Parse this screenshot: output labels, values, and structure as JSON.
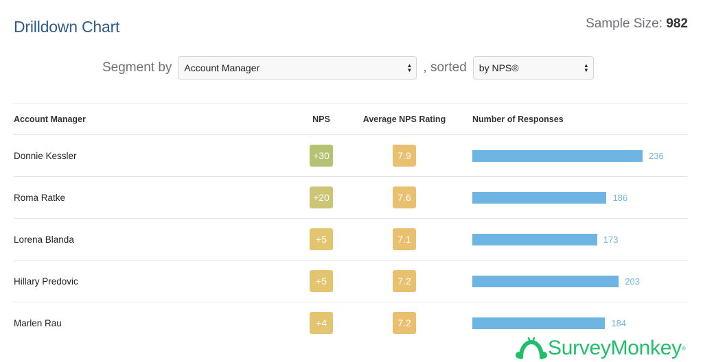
{
  "header": {
    "title": "Drilldown Chart",
    "sample_size_label": "Sample Size:",
    "sample_size_value": "982"
  },
  "controls": {
    "segment_label": "Segment by",
    "segment_value": "Account Manager",
    "sorted_label": ", sorted",
    "sort_value": "by NPS®"
  },
  "colors": {
    "title": "#2d5a8a",
    "bar": "#6fb5e3",
    "nps_high": "#b5c272",
    "nps_mid": "#cbc575",
    "nps_low": "#e4c56f",
    "avg": "#e9c06f",
    "brand": "#1fbf6a"
  },
  "chart_data": {
    "type": "table",
    "title": "Drilldown Chart",
    "columns": [
      "Account Manager",
      "NPS",
      "Average NPS Rating",
      "Number of Responses"
    ],
    "rows": [
      {
        "name": "Donnie Kessler",
        "nps": "+30",
        "avg": "7.9",
        "responses": 236,
        "nps_color": "#b5c272"
      },
      {
        "name": "Roma Ratke",
        "nps": "+20",
        "avg": "7.6",
        "responses": 186,
        "nps_color": "#cbc575"
      },
      {
        "name": "Lorena Blanda",
        "nps": "+5",
        "avg": "7.1",
        "responses": 173,
        "nps_color": "#e4c56f"
      },
      {
        "name": "Hillary Predovic",
        "nps": "+5",
        "avg": "7.2",
        "responses": 203,
        "nps_color": "#e4c56f"
      },
      {
        "name": "Marlen Rau",
        "nps": "+4",
        "avg": "7.2",
        "responses": 184,
        "nps_color": "#e4c56f"
      }
    ],
    "bar_max": 236
  },
  "brand": {
    "name": "SurveyMonkey",
    "reg": "®"
  }
}
